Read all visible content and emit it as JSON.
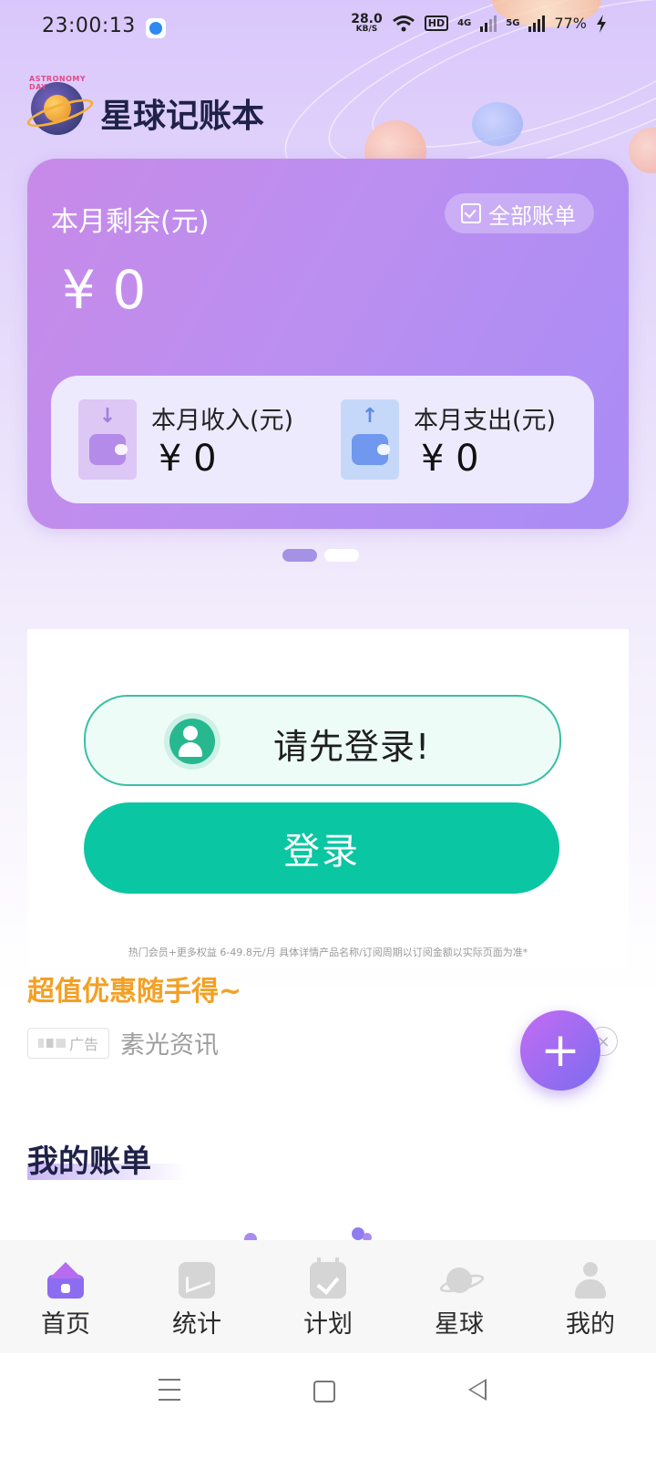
{
  "status_bar": {
    "time": "23:00:13",
    "net_speed_value": "28.0",
    "net_speed_unit": "KB/S",
    "hd_badge": "HD",
    "net_4g": "4G",
    "net_5g": "5G",
    "battery": "77%"
  },
  "header": {
    "app_name": "星球记账本",
    "logo_text": "ASTRONOMY DAY"
  },
  "summary_card": {
    "remaining_label": "本月剩余(元)",
    "remaining_amount": "¥ 0",
    "all_bills_button": "全部账单",
    "income_label": "本月收入(元)",
    "income_amount": "¥ 0",
    "expense_label": "本月支出(元)",
    "expense_amount": "¥ 0"
  },
  "carousel": {
    "active_index": 0,
    "count": 2
  },
  "login_panel": {
    "tip": "请先登录!",
    "login_button": "登录",
    "fine_print": "热门会员+更多权益 6-49.8元/月 具体详情产品名称/订阅周期以订阅金额以实际页面为准*"
  },
  "ad": {
    "promo_title": "超值优惠随手得~",
    "tag": "广告",
    "source": "素光资讯",
    "close_glyph": "×"
  },
  "fab": {
    "label": "+"
  },
  "my_bills": {
    "title": "我的账单"
  },
  "bottom_nav": {
    "items": [
      {
        "label": "首页",
        "icon": "home-icon",
        "active": true
      },
      {
        "label": "统计",
        "icon": "stats-icon",
        "active": false
      },
      {
        "label": "计划",
        "icon": "plan-icon",
        "active": false
      },
      {
        "label": "星球",
        "icon": "planet-icon",
        "active": false
      },
      {
        "label": "我的",
        "icon": "profile-icon",
        "active": false
      }
    ]
  },
  "colors": {
    "accent_purple": "#8c6cf0",
    "login_green": "#0bc6a2",
    "promo_orange": "#f3a024"
  }
}
